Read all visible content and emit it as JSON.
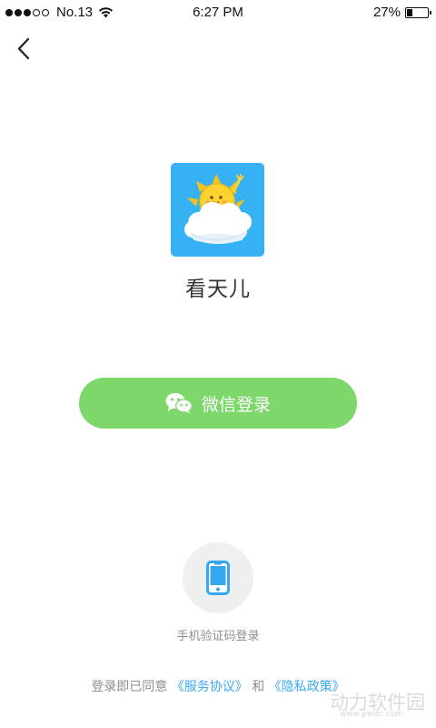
{
  "status_bar": {
    "signal_dots_filled": 3,
    "signal_dots_total": 5,
    "carrier": "No.13",
    "time": "6:27 PM",
    "battery_percent": "27%",
    "battery_level": 0.27
  },
  "header": {
    "back_icon": "chevron-left-icon"
  },
  "app": {
    "icon": "sun-on-cloud-logo",
    "icon_color": "#36b1f4",
    "name": "看天儿"
  },
  "wechat_login": {
    "label": "微信登录",
    "icon": "wechat-icon",
    "color": "#7dd76b"
  },
  "phone_login": {
    "icon": "mobile-phone-icon",
    "label": "手机验证码登录"
  },
  "agreement": {
    "prefix": "登录即已同意",
    "service_link": "《服务协议》",
    "conjunction": "和",
    "privacy_link": "《隐私政策》",
    "link_color": "#3aa9f1"
  },
  "watermark": {
    "text": "动力软件园",
    "url": "www.pwdc.com"
  }
}
